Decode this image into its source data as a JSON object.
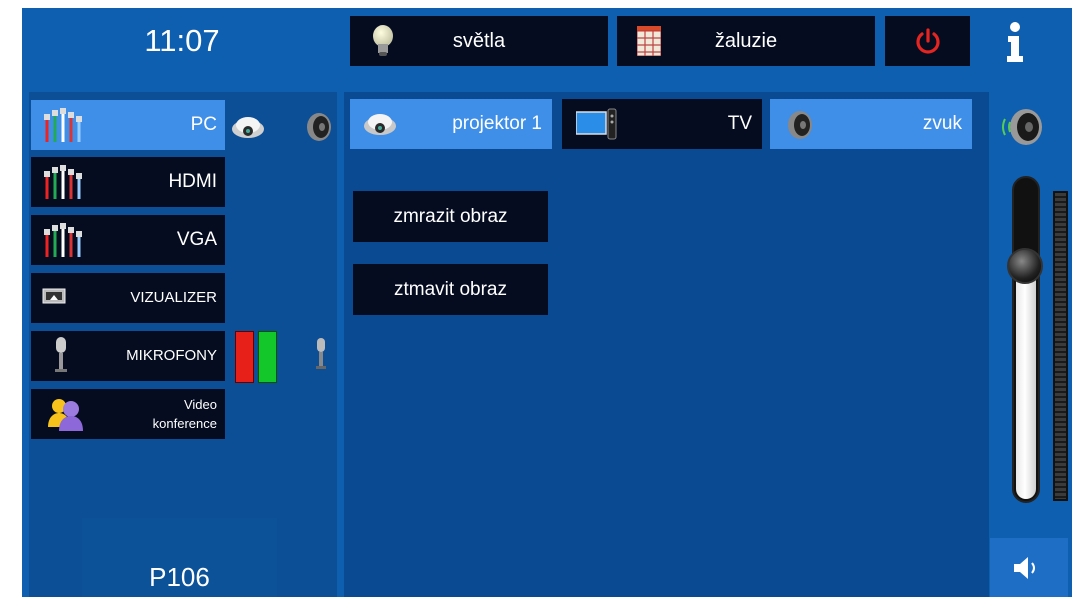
{
  "header": {
    "clock": "11:07",
    "lights_label": "světla",
    "blinds_label": "žaluzie",
    "power_icon": "power-icon",
    "info_icon": "info-icon"
  },
  "sources": [
    {
      "label": "PC",
      "icon": "cables-icon",
      "active": true
    },
    {
      "label": "HDMI",
      "icon": "cables-icon",
      "active": false
    },
    {
      "label": "VGA",
      "icon": "cables-icon",
      "active": false
    },
    {
      "label": "VIZUALIZER",
      "icon": "visualizer-icon",
      "active": false
    },
    {
      "label": "MIKROFONY",
      "icon": "microphone-icon",
      "active": false
    },
    {
      "label_line1": "Video",
      "label_line2": "konference",
      "icon": "users-icon",
      "active": false
    }
  ],
  "outputs": {
    "projector_label": "projektor 1",
    "tv_label": "TV",
    "sound_label": "zvuk"
  },
  "commands": {
    "freeze_label": "zmrazit obraz",
    "dim_label": "ztmavit obraz"
  },
  "room": {
    "name": "P106"
  },
  "volume": {
    "level": 0.7
  },
  "colors": {
    "background": "#0f5fb0",
    "button": "#050c20",
    "active": "#3f8fe8",
    "mic_red": "#e8201a",
    "mic_green": "#13c62a",
    "power_red": "#e52521"
  }
}
